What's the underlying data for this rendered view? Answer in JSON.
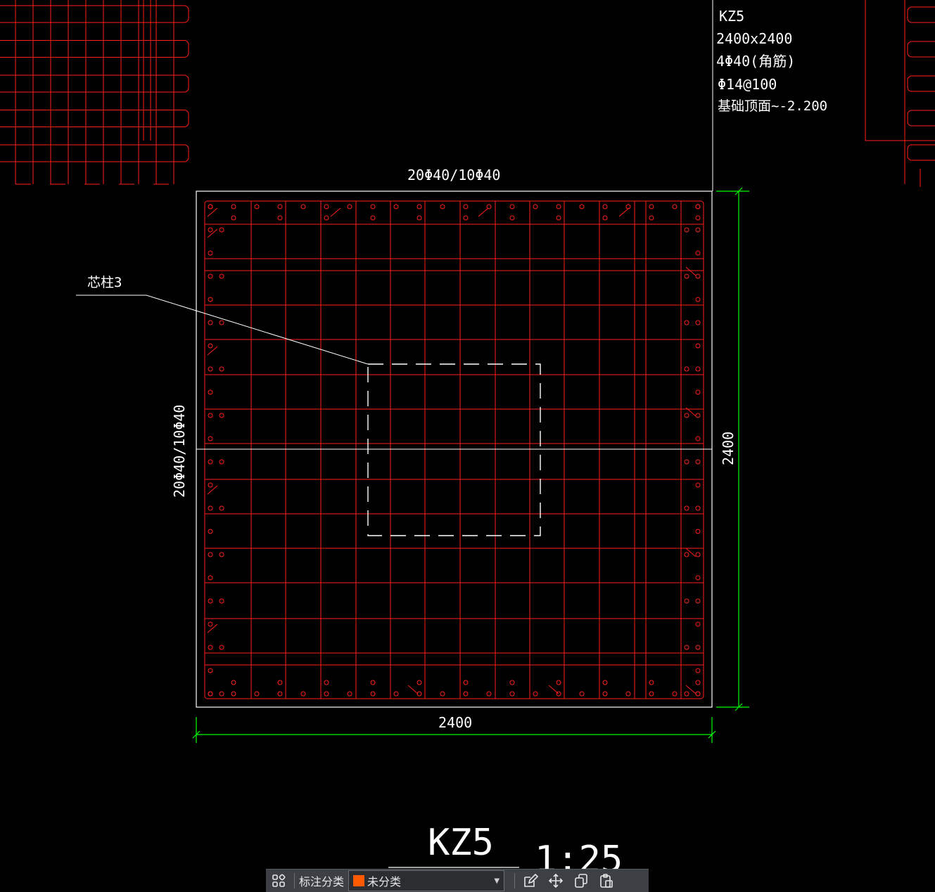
{
  "drawing": {
    "column_id": "KZ5",
    "column_size": "2400x2400",
    "corner_bars": "4Φ40(角筋)",
    "stirrups": "Φ14@100",
    "elevation_range": "基础顶面~-2.200",
    "top_bar_note": "20Φ40/10Φ40",
    "side_bar_note": "20Φ40/10Φ40",
    "core_label": "芯柱3",
    "dim_horizontal": "2400",
    "dim_vertical": "2400",
    "title": "KZ5",
    "scale": "1:25"
  },
  "colors": {
    "rebar": "#ff1f1f",
    "outline": "#ffffff",
    "dimension": "#00ff00",
    "background": "#000000",
    "tag_swatch": "#ff5a00"
  },
  "toolbar": {
    "grid_icon": "apps-grid-icon",
    "label": "标注分类",
    "category_value": "未分类",
    "icons": [
      "edit-icon",
      "move-icon",
      "copy-icon",
      "paste-icon"
    ]
  }
}
